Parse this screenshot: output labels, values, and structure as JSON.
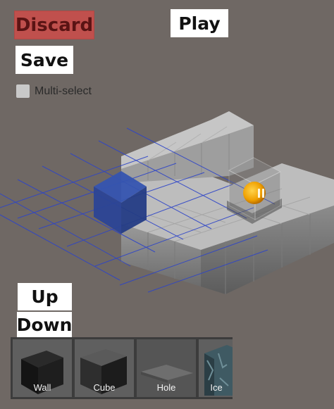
{
  "toolbar": {
    "discard_label": "Discard",
    "play_label": "Play",
    "save_label": "Save",
    "multiselect_label": "Multi-select",
    "multiselect_checked": false
  },
  "layer": {
    "up_label": "Up",
    "down_label": "Down"
  },
  "palette": {
    "items": [
      {
        "label": "Wall",
        "icon": "wall-block-icon"
      },
      {
        "label": "Cube",
        "icon": "cube-block-icon"
      },
      {
        "label": "Hole",
        "icon": "hole-tile-icon"
      },
      {
        "label": "Ice",
        "icon": "ice-block-icon"
      }
    ]
  },
  "colors": {
    "background": "#6f6864",
    "discard": "#c0504d",
    "selection": "#2f4fa8",
    "grid": "#2d44c8",
    "ball": "#f0a800"
  }
}
